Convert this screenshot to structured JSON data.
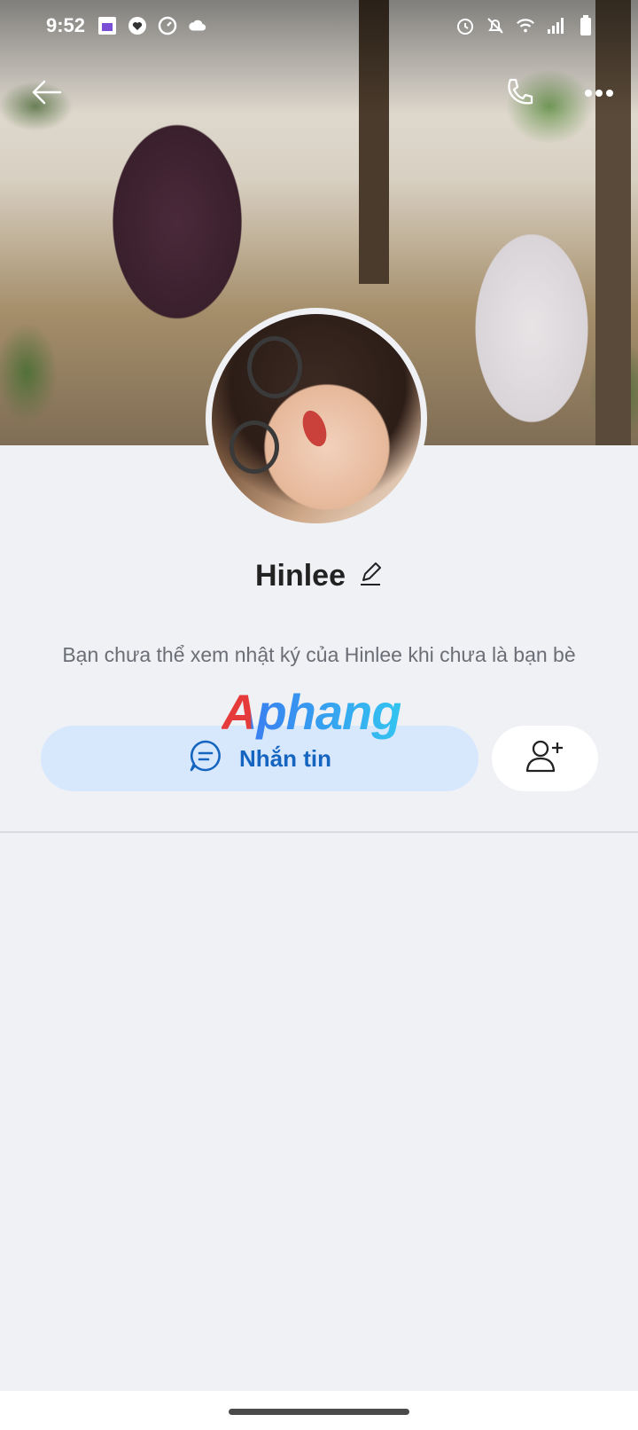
{
  "status_bar": {
    "time": "9:52",
    "left_icons": [
      "app-notification-icon",
      "heart-icon",
      "gauge-icon",
      "cloud-icon"
    ],
    "right_icons": [
      "alarm-icon",
      "bell-off-icon",
      "wifi-icon",
      "signal-icon",
      "battery-icon"
    ]
  },
  "header": {
    "back_icon": "arrow-left-icon",
    "call_icon": "phone-icon",
    "more_icon": "more-horizontal-icon"
  },
  "profile": {
    "name": "Hinlee",
    "edit_icon": "pencil-icon",
    "notice": "Bạn chưa thể xem nhật ký của Hinlee khi chưa là bạn bè"
  },
  "watermark": "Aphang",
  "actions": {
    "message_label": "Nhắn tin",
    "message_icon": "chat-bubble-icon",
    "add_friend_icon": "add-user-icon"
  },
  "colors": {
    "background": "#f0f1f5",
    "message_button_bg": "#d7e8fd",
    "message_button_text": "#1565c0"
  }
}
